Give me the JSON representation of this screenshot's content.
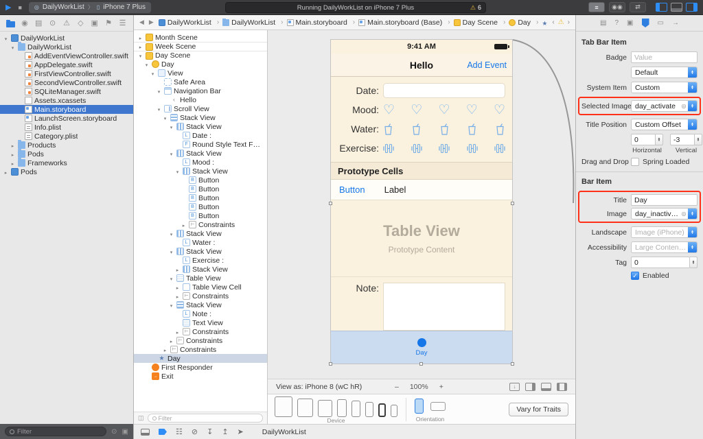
{
  "icons": {
    "play": "▶",
    "stop": "■",
    "chevron": "〉",
    "back": "◀",
    "forward": "▶",
    "jb_back": "‹",
    "jb_forward": "›",
    "warning": "⚠",
    "minus": "–",
    "plus": "+",
    "target": "◎",
    "phone": "▯"
  },
  "toolbar": {
    "scheme": "DailyWorkList",
    "device": "iPhone 7 Plus",
    "status": "Running DailyWorkList on iPhone 7 Plus",
    "warning_count": "6"
  },
  "navigator": {
    "filter_placeholder": "Filter",
    "items": [
      {
        "label": "DailyWorkList",
        "icon": "project",
        "depth": 0,
        "arrow": "open"
      },
      {
        "label": "DailyWorkList",
        "icon": "folder",
        "depth": 1,
        "arrow": "open"
      },
      {
        "label": "AddEventViewController.swift",
        "icon": "swift",
        "depth": 2
      },
      {
        "label": "AppDelegate.swift",
        "icon": "swift",
        "depth": 2
      },
      {
        "label": "FirstViewController.swift",
        "icon": "swift",
        "depth": 2
      },
      {
        "label": "SecondViewController.swift",
        "icon": "swift",
        "depth": 2
      },
      {
        "label": "SQLiteManager.swift",
        "icon": "swift",
        "depth": 2
      },
      {
        "label": "Assets.xcassets",
        "icon": "assets",
        "depth": 2
      },
      {
        "label": "Main.storyboard",
        "icon": "storyboard",
        "depth": 2,
        "selected": true
      },
      {
        "label": "LaunchScreen.storyboard",
        "icon": "storyboard",
        "depth": 2
      },
      {
        "label": "Info.plist",
        "icon": "plist",
        "depth": 2
      },
      {
        "label": "Category.plist",
        "icon": "plist",
        "depth": 2
      },
      {
        "label": "Products",
        "icon": "folder",
        "depth": 1,
        "arrow": "closed"
      },
      {
        "label": "Pods",
        "icon": "folder",
        "depth": 1,
        "arrow": "closed"
      },
      {
        "label": "Frameworks",
        "icon": "folder",
        "depth": 1,
        "arrow": "closed"
      },
      {
        "label": "Pods",
        "icon": "project",
        "depth": 0,
        "arrow": "closed"
      }
    ]
  },
  "jumpbar": {
    "crumbs": [
      {
        "label": "DailyWorkList",
        "icon": "project"
      },
      {
        "label": "DailyWorkList",
        "icon": "folder"
      },
      {
        "label": "Main.storyboard",
        "icon": "storyboard"
      },
      {
        "label": "Main.storyboard (Base)",
        "icon": "storyboard"
      },
      {
        "label": "Day Scene",
        "icon": "scene"
      },
      {
        "label": "Day",
        "icon": "vc"
      },
      {
        "label": "Day",
        "icon": "tabitem"
      }
    ]
  },
  "outline": {
    "filter_placeholder": "Filter",
    "items": [
      {
        "label": "Month Scene",
        "icon": "scene",
        "depth": 0,
        "arrow": "closed"
      },
      {
        "label": "Week Scene",
        "icon": "scene",
        "depth": 0,
        "arrow": "closed",
        "sep": true
      },
      {
        "label": "Day Scene",
        "icon": "scene",
        "depth": 0,
        "arrow": "open",
        "sep": true
      },
      {
        "label": "Day",
        "icon": "vc",
        "depth": 1,
        "arrow": "open"
      },
      {
        "label": "View",
        "icon": "view",
        "depth": 2,
        "arrow": "open"
      },
      {
        "label": "Safe Area",
        "icon": "safearea",
        "depth": 3
      },
      {
        "label": "Navigation Bar",
        "icon": "navbar",
        "depth": 3,
        "arrow": "open"
      },
      {
        "label": "Hello",
        "icon": "navitem",
        "depth": 4
      },
      {
        "label": "Scroll View",
        "icon": "scroll",
        "depth": 3,
        "arrow": "open"
      },
      {
        "label": "Stack View",
        "icon": "stackv",
        "depth": 4,
        "arrow": "open"
      },
      {
        "label": "Stack View",
        "icon": "stackh",
        "depth": 5,
        "arrow": "open"
      },
      {
        "label": "Date :",
        "icon": "labelL",
        "depth": 6
      },
      {
        "label": "Round Style Text F…",
        "icon": "field",
        "depth": 6
      },
      {
        "label": "Stack View",
        "icon": "stackh",
        "depth": 5,
        "arrow": "open"
      },
      {
        "label": "Mood :",
        "icon": "labelL",
        "depth": 6
      },
      {
        "label": "Stack View",
        "icon": "stackh",
        "depth": 6,
        "arrow": "open"
      },
      {
        "label": "Button",
        "icon": "button",
        "depth": 7
      },
      {
        "label": "Button",
        "icon": "button",
        "depth": 7
      },
      {
        "label": "Button",
        "icon": "button",
        "depth": 7
      },
      {
        "label": "Button",
        "icon": "button",
        "depth": 7
      },
      {
        "label": "Button",
        "icon": "button",
        "depth": 7
      },
      {
        "label": "Constraints",
        "icon": "constraints",
        "depth": 7,
        "arrow": "closed"
      },
      {
        "label": "Stack View",
        "icon": "stackh",
        "depth": 5,
        "arrow": "open"
      },
      {
        "label": "Water :",
        "icon": "labelL",
        "depth": 6
      },
      {
        "label": "Stack View",
        "icon": "stackh",
        "depth": 5,
        "arrow": "open"
      },
      {
        "label": "Exercise :",
        "icon": "labelL",
        "depth": 6
      },
      {
        "label": "Stack View",
        "icon": "stackh",
        "depth": 6,
        "arrow": "closed"
      },
      {
        "label": "Table View",
        "icon": "table",
        "depth": 5,
        "arrow": "open"
      },
      {
        "label": "Table View Cell",
        "icon": "cell",
        "depth": 6,
        "arrow": "closed"
      },
      {
        "label": "Constraints",
        "icon": "constraints",
        "depth": 6,
        "arrow": "closed"
      },
      {
        "label": "Stack View",
        "icon": "stackv",
        "depth": 5,
        "arrow": "open"
      },
      {
        "label": "Note :",
        "icon": "labelL",
        "depth": 6
      },
      {
        "label": "Text View",
        "icon": "textview",
        "depth": 6
      },
      {
        "label": "Constraints",
        "icon": "constraints",
        "depth": 6,
        "arrow": "closed"
      },
      {
        "label": "Constraints",
        "icon": "constraints",
        "depth": 5,
        "arrow": "closed"
      },
      {
        "label": "Constraints",
        "icon": "constraints",
        "depth": 4,
        "arrow": "closed"
      },
      {
        "label": "Day",
        "icon": "tabitem",
        "depth": 2,
        "selected": true
      },
      {
        "label": "First Responder",
        "icon": "firstresponder",
        "depth": 1
      },
      {
        "label": "Exit",
        "icon": "exit",
        "depth": 1
      }
    ]
  },
  "canvas": {
    "phone": {
      "time": "9:41 AM",
      "nav_title": "Hello",
      "nav_action": "Add Event",
      "date_label": "Date:",
      "mood_label": "Mood:",
      "water_label": "Water:",
      "exercise_label": "Exercise:",
      "section_header": "Prototype Cells",
      "cell_button": "Button",
      "cell_label": "Label",
      "table_title": "Table View",
      "table_subtitle": "Prototype Content",
      "note_label": "Note:",
      "tab_label": "Day"
    },
    "bottom": {
      "view_as": "View as: iPhone 8 (wC hR)",
      "zoom": "100%"
    },
    "device_bar": {
      "device_label": "Device",
      "orientation_label": "Orientation",
      "vary_button": "Vary for Traits"
    }
  },
  "debug": {
    "app_label": "DailyWorkList"
  },
  "inspector": {
    "tbi": {
      "title": "Tab Bar Item",
      "badge_label": "Badge",
      "badge_placeholder": "Value",
      "badge_color_value": "Default",
      "system_item_label": "System Item",
      "system_item_value": "Custom",
      "selected_image_label": "Selected Image",
      "selected_image_value": "day_activate",
      "title_position_label": "Title Position",
      "title_position_value": "Custom Offset",
      "offset_h": "0",
      "offset_h_label": "Horizontal",
      "offset_v": "-3",
      "offset_v_label": "Vertical",
      "dragdrop_label": "Drag and Drop",
      "dragdrop_option": "Spring Loaded"
    },
    "bar": {
      "title": "Bar Item",
      "title_label": "Title",
      "title_value": "Day",
      "image_label": "Image",
      "image_value": "day_inactivate",
      "landscape_label": "Landscape",
      "landscape_placeholder": "Image (iPhone)",
      "accessibility_label": "Accessibility",
      "accessibility_placeholder": "Large Content Size Image",
      "tag_label": "Tag",
      "tag_value": "0",
      "enabled_label": "Enabled"
    }
  }
}
